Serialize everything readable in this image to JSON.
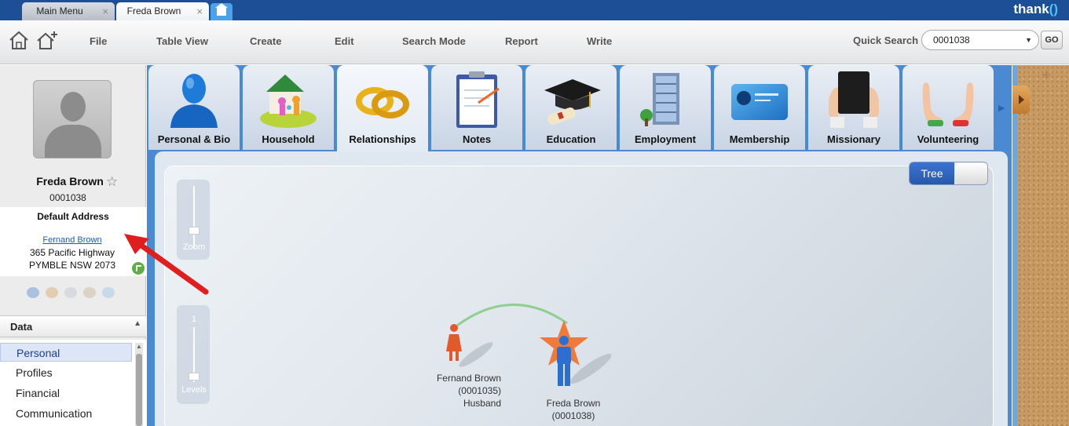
{
  "tabs": [
    {
      "label": "Main Menu",
      "close": "×"
    },
    {
      "label": "Freda Brown",
      "close": "×"
    }
  ],
  "brand": {
    "text": "thank",
    "bracket": "()"
  },
  "toolbar": {
    "menu": [
      "File",
      "Table View",
      "Create",
      "Edit",
      "Search Mode",
      "Report",
      "Write"
    ],
    "quick_search_label": "Quick Search",
    "quick_search_value": "0001038",
    "go_label": "GO"
  },
  "profile": {
    "name": "Freda Brown",
    "id": "0001038",
    "address_title": "Default Address",
    "address_link": "Fernand Brown",
    "address_line1": "365 Pacific Highway",
    "address_line2": "PYMBLE NSW 2073"
  },
  "data_section": {
    "title": "Data",
    "items": [
      {
        "label": "Personal",
        "selected": true
      },
      {
        "label": "Profiles",
        "selected": false
      },
      {
        "label": "Financial",
        "selected": false
      },
      {
        "label": "Communication",
        "selected": false
      }
    ]
  },
  "content_tabs": [
    {
      "label": "Personal & Bio",
      "icon": "person-icon"
    },
    {
      "label": "Household",
      "icon": "household-icon"
    },
    {
      "label": "Relationships",
      "icon": "rings-icon",
      "selected": true
    },
    {
      "label": "Notes",
      "icon": "clipboard-icon"
    },
    {
      "label": "Education",
      "icon": "graduation-cap-icon"
    },
    {
      "label": "Employment",
      "icon": "building-icon"
    },
    {
      "label": "Membership",
      "icon": "membership-card-icon"
    },
    {
      "label": "Missionary",
      "icon": "bible-icon"
    },
    {
      "label": "Volunteering",
      "icon": "hands-icon"
    }
  ],
  "relationship_view": {
    "toggle_label": "Tree",
    "zoom_label": "Zoom",
    "levels_label": "Levels",
    "levels_value": "1",
    "nodes": [
      {
        "name": "Fernand Brown",
        "id": "(0001035)",
        "role": "Husband"
      },
      {
        "name": "Freda Brown",
        "id": "(0001038)"
      }
    ]
  },
  "colors": {
    "brand_blue": "#1d4f97",
    "female_node": "#e05a2c",
    "male_node": "#2c6fd0",
    "star": "#f07a3b",
    "link_arc": "#8fcf8f",
    "annotation_arrow": "#e01e1e"
  }
}
